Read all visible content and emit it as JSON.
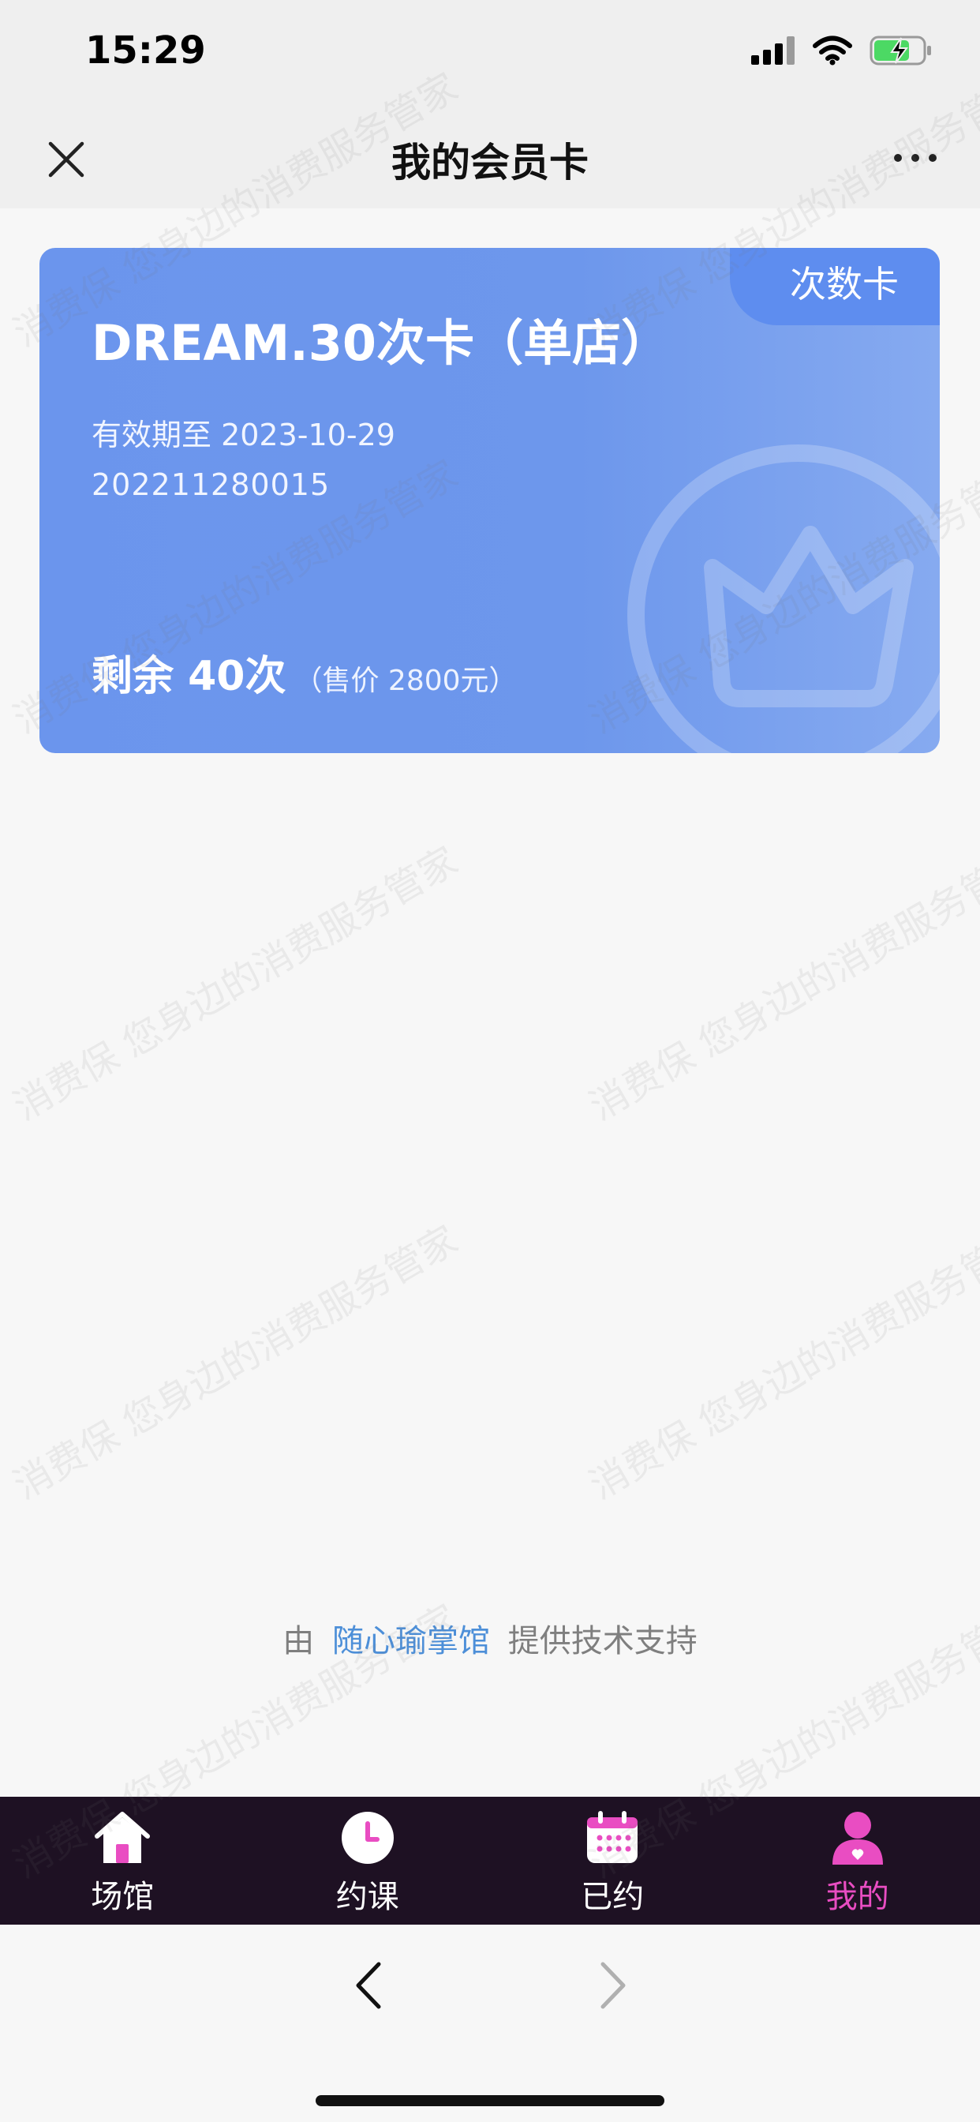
{
  "status_bar": {
    "time": "15:29"
  },
  "nav": {
    "title": "我的会员卡"
  },
  "card": {
    "tag": "次数卡",
    "name": "DREAM.30次卡（单店）",
    "validity": "有效期至 2023-10-29",
    "number": "202211280015",
    "remaining": "剩余 40次",
    "price": "（售价 2800元）"
  },
  "credit": {
    "prefix": "由",
    "brand": "随心瑜掌馆",
    "suffix": "提供技术支持"
  },
  "tabs": [
    {
      "label": "场馆",
      "icon": "home-icon"
    },
    {
      "label": "约课",
      "icon": "clock-icon"
    },
    {
      "label": "已约",
      "icon": "calendar-icon"
    },
    {
      "label": "我的",
      "icon": "user-icon",
      "active": true
    }
  ],
  "watermark": {
    "text": "消费保 您身边的消费服务管家"
  },
  "colors": {
    "card": "#6b95ed",
    "tab_bar": "#1e1123",
    "tab_active": "#e94dc2",
    "credit_link": "#4d8fd8"
  }
}
